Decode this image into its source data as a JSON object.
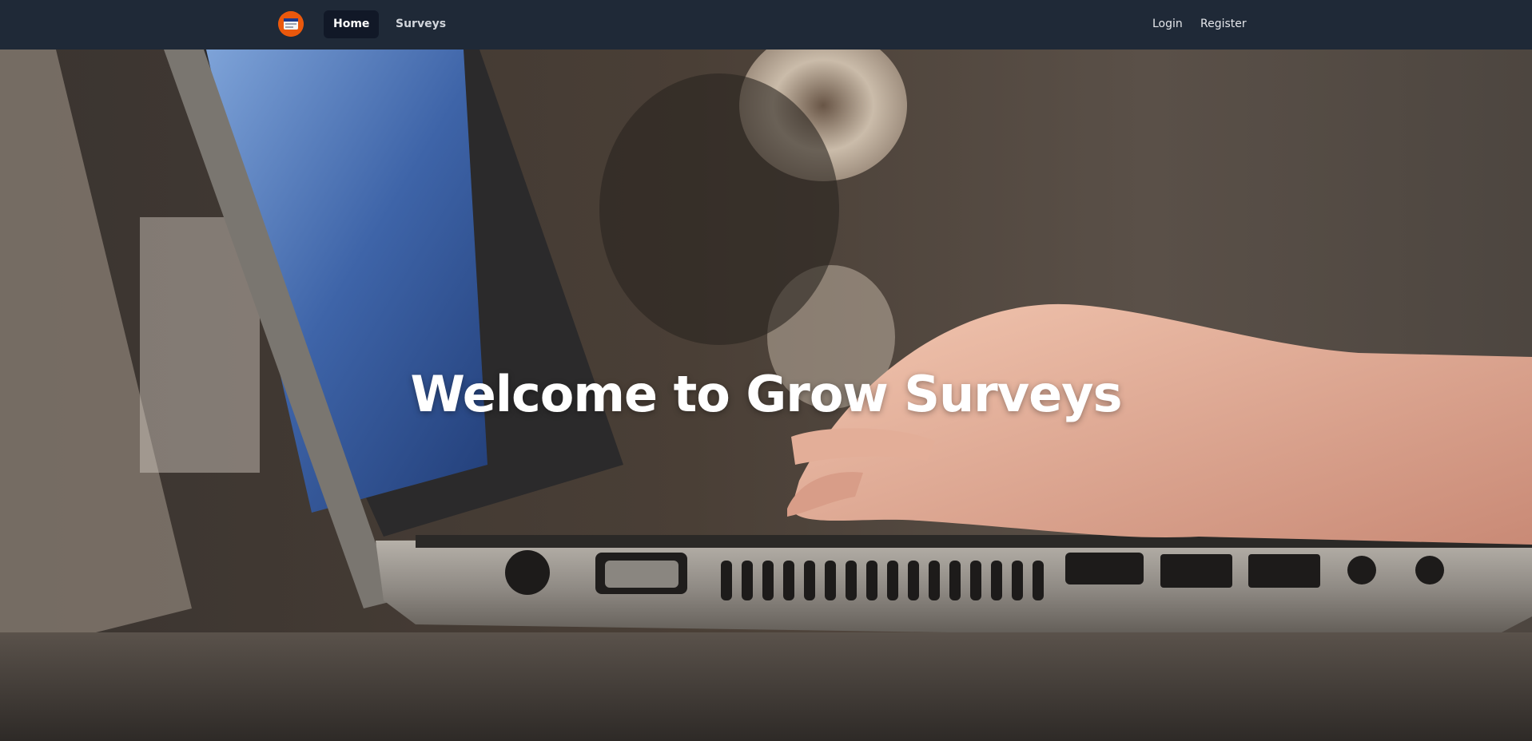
{
  "app": {
    "logo_icon": "survey-logo-icon",
    "accent_color": "#ea580c"
  },
  "nav": {
    "home_label": "Home",
    "surveys_label": "Surveys",
    "login_label": "Login",
    "register_label": "Register",
    "active": "Home"
  },
  "hero": {
    "title": "Welcome to Grow Surveys",
    "background": "laptop-typing-photo"
  }
}
